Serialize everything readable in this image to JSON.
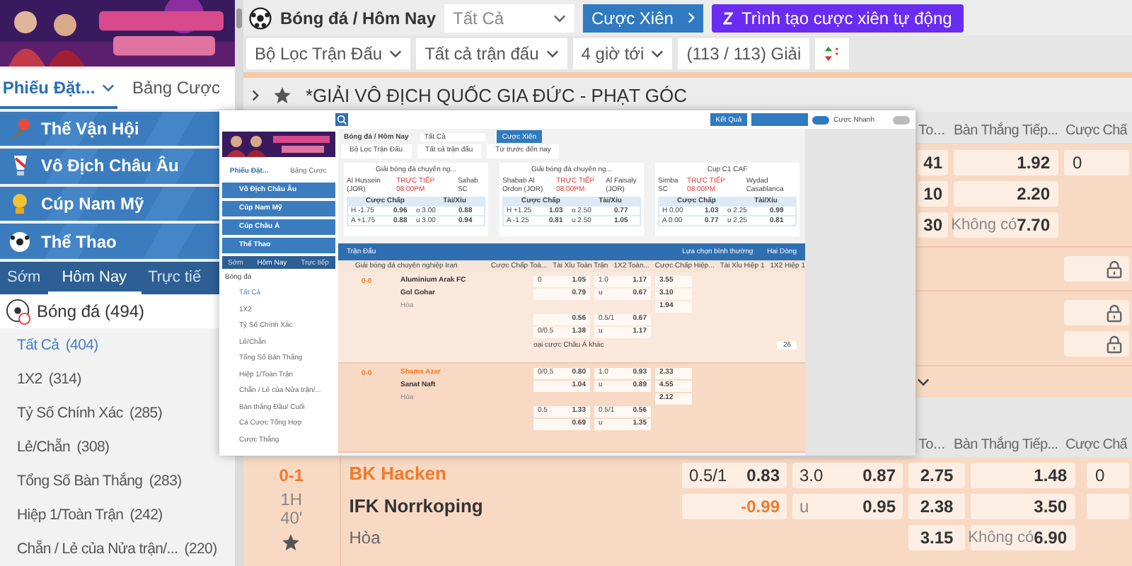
{
  "sidebar": {
    "tabs": [
      {
        "label": "Phiếu Đặt...",
        "selected": true
      },
      {
        "label": "Bảng Cược",
        "selected": false
      }
    ],
    "categories": [
      {
        "label": "Thế Vận Hội",
        "kind": "torch"
      },
      {
        "label": "Vô Địch Châu Âu",
        "kind": "trophy"
      },
      {
        "label": "Cúp Nam Mỹ",
        "kind": "medal"
      },
      {
        "label": "Thể Thao",
        "kind": "ball"
      }
    ],
    "period_tabs": [
      {
        "label": "Sớm",
        "selected": false
      },
      {
        "label": "Hôm Nay",
        "selected": true
      },
      {
        "label": "Trực tiế",
        "selected": false
      }
    ],
    "sport": {
      "label": "Bóng đá",
      "count": "(494)"
    },
    "markets": [
      {
        "label": "Tất Cả",
        "count": "(404)",
        "selected": true
      },
      {
        "label": "1X2",
        "count": "(314)",
        "selected": false
      },
      {
        "label": "Tỷ Số Chính Xác",
        "count": "(285)",
        "selected": false
      },
      {
        "label": "Lẻ/Chẵn",
        "count": "(308)",
        "selected": false
      },
      {
        "label": "Tổng Số Bàn Thắng",
        "count": "(283)",
        "selected": false
      },
      {
        "label": "Hiệp 1/Toàn Trận",
        "count": "(242)",
        "selected": false
      },
      {
        "label": "Chẵn / Lẻ của Nửa trận/...",
        "count": "(220)",
        "selected": false
      }
    ]
  },
  "header": {
    "title": "Bóng đá / Hôm Nay",
    "market_select": "Tất Cả",
    "parlay_button": "Cược Xiên",
    "auto_parlay_button": "Trình tạo cược xiên tự động"
  },
  "filters": [
    "Bộ Lọc Trận Đấu",
    "Tất cả trận đấu",
    "4 giờ tới"
  ],
  "league_count": "(113 / 113) Giải",
  "league_bar": {
    "title": "*GIẢI VÔ ĐỊCH QUỐC GIA ĐỨC - PHẠT GÓC"
  },
  "columns": [
    "To...",
    "Bàn Thắng Tiếp...",
    "Cược Chấ"
  ],
  "upper_groups": [
    {
      "rows": [
        {
          "kind": "odds",
          "total": "41",
          "next_goal": "1.92",
          "handicap": "0"
        },
        {
          "kind": "odds",
          "total": "10",
          "next_goal": "2.20"
        },
        {
          "kind": "odds",
          "total": "30",
          "note": "Không có",
          "next_goal": "7.70"
        }
      ]
    },
    {
      "rows": [
        {
          "kind": "locked"
        }
      ]
    },
    {
      "rows": [
        {
          "kind": "locked"
        },
        {
          "kind": "locked"
        }
      ]
    }
  ],
  "columns_repeat": [
    "To...",
    "Bàn Thắng Tiếp...",
    "Cược Chấ"
  ],
  "match": {
    "score": "0-1",
    "period": "1H",
    "minute": "40'",
    "home": "BK Hacken",
    "away": "IFK Norrkoping",
    "draw": "Hòa",
    "rows": [
      {
        "hdp_line": "0.5/1",
        "hdp_odds": "0.83",
        "negative": false,
        "ou_line": "3.0",
        "ou_odds": "0.87",
        "x12": "2.75",
        "next_goal": "1.48",
        "handicap": "0"
      },
      {
        "hdp_odds": "-0.99",
        "negative": true,
        "ou_line": "u",
        "ou_odds": "0.95",
        "x12": "2.38",
        "next_goal": "3.50"
      },
      {
        "x12": "3.15",
        "note": "Không có",
        "next_goal": "6.90"
      }
    ]
  },
  "inset": {
    "toolbar": {
      "results_button": "Kết Quả",
      "quick_bet": {
        "label": "Cược Nhanh",
        "on": true
      },
      "second_toggle": {
        "on": false
      }
    },
    "sidebar": {
      "tabs": [
        {
          "label": "Phiếu Đặt...",
          "selected": true
        },
        {
          "label": "Bảng Cược",
          "selected": false
        }
      ],
      "categories": [
        {
          "label": "Vô Địch Châu Âu"
        },
        {
          "label": "Cúp Nam Mỹ"
        },
        {
          "label": "Cúp Châu Á"
        },
        {
          "label": "Thể Thao"
        }
      ],
      "period_tabs": [
        {
          "label": "Sớm",
          "selected": false
        },
        {
          "label": "Hôm Nay",
          "selected": true
        },
        {
          "label": "Trực tiếp",
          "selected": false
        }
      ],
      "sport": "Bóng đá",
      "markets": [
        {
          "label": "Tất Cả",
          "selected": true
        },
        {
          "label": "1X2",
          "selected": false
        },
        {
          "label": "Tỷ Số Chính Xác",
          "selected": false
        },
        {
          "label": "Lẻ/Chẵn",
          "selected": false
        },
        {
          "label": "Tổng Số Bàn Thắng",
          "selected": false
        },
        {
          "label": "Hiệp 1/Toàn Trận",
          "selected": false
        },
        {
          "label": "Chẵn / Lẻ của Nửa trận/...",
          "selected": false
        },
        {
          "label": "Bàn thắng Đầu/ Cuối",
          "selected": false
        },
        {
          "label": "Cá Cược Tổng Hợp",
          "selected": false
        },
        {
          "label": "Cược Thắng",
          "selected": false
        }
      ]
    },
    "header": {
      "title": "Bóng đá / Hôm Nay",
      "market_select": "Tất Cả",
      "parlay_button": "Cược Xiên"
    },
    "filters": [
      "Bộ Lọc Trận Đấu",
      "Tất cả trận đấu",
      "Từ trước đến nay"
    ],
    "featured": [
      {
        "league": "Giải bóng đá chuyên ng...",
        "home": "Al Hussein (JOR)",
        "status": "TRỰC TIẾP 08:00PM",
        "away": "Sahab SC",
        "heads": [
          "Cược Chấp",
          "Tài/Xỉu"
        ],
        "odds": [
          [
            "H -1.75",
            "0.96",
            "o 3.00",
            "0.88"
          ],
          [
            "A +1.75",
            "0.88",
            "u 3.00",
            "0.94"
          ]
        ]
      },
      {
        "league": "Giải bóng đá chuyên ng...",
        "home": "Shabab Al Ordon (JOR)",
        "status": "TRỰC TIẾP 08:00PM",
        "away": "Al Faisaly (JOR)",
        "heads": [
          "Cược Chấp",
          "Tài/Xỉu"
        ],
        "odds": [
          [
            "H +1.25",
            "1.03",
            "o 2.50",
            "0.77"
          ],
          [
            "A -1.25",
            "0.81",
            "u 2.50",
            "1.05"
          ]
        ]
      },
      {
        "league": "Cup C1 CAF",
        "home": "Simba SC",
        "status": "TRỰC TIẾP 08:00PM",
        "away": "Wydad Casablanca",
        "heads": [
          "Cược Chấp",
          "Tài/Xỉu"
        ],
        "odds": [
          [
            "H 0.00",
            "1.03",
            "o 2.25",
            "0.99"
          ],
          [
            "A 0.00",
            "0.77",
            "u 2.25",
            "0.81"
          ]
        ]
      }
    ],
    "bar": {
      "title": "Trận Đấu",
      "view": "Lựa chọn bình thường",
      "lines": "Hai Dòng"
    },
    "league": "Giải bóng đá chuyên nghiệp Iran",
    "columns": [
      "Cược Chấp Toà...",
      "Tài Xỉu Toàn Trận",
      "1X2 Toàn...",
      "Cược Chấp Hiệp...",
      "Tài Xỉu Hiệp 1",
      "1X2 Hiệp 1"
    ],
    "matches": [
      {
        "score": "0-0",
        "home": "Aluminium Arak FC",
        "home_highlight": false,
        "away": "Gol Gohar",
        "draw": "Hòa",
        "lines": [
          {
            "hdp_line": "0",
            "hdp": "1.05",
            "ou_line": "1.0",
            "ou": "1.17",
            "x12": "3.55"
          },
          {
            "hdp": "0.79",
            "ou_line": "u",
            "ou": "0.67",
            "x12": "3.10"
          },
          {
            "x12": "1.94"
          },
          {
            "hdp": "0.56",
            "ou_line": "0.5/1",
            "ou": "0.67"
          },
          {
            "hdp_line": "0/0.5",
            "hdp": "1.38",
            "ou_line": "u",
            "ou": "1.17"
          }
        ],
        "more": "oại cược Châu Á khác",
        "count": "26"
      },
      {
        "score": "0-0",
        "home": "Shams Azar",
        "home_highlight": true,
        "away": "Sanat Naft",
        "draw": "Hòa",
        "lines": [
          {
            "hdp_line": "0/0.5",
            "hdp": "0.80",
            "ou_line": "1.0",
            "ou": "0.93",
            "x12": "2.33"
          },
          {
            "hdp": "1.04",
            "ou_line": "u",
            "ou": "0.89",
            "x12": "4.55"
          },
          {
            "x12": "2.12"
          },
          {
            "hdp_line": "0.5",
            "hdp": "1.33",
            "ou_line": "0.5/1",
            "ou": "0.56"
          },
          {
            "hdp": "0.69",
            "ou_line": "u",
            "ou": "1.35"
          }
        ]
      }
    ]
  }
}
